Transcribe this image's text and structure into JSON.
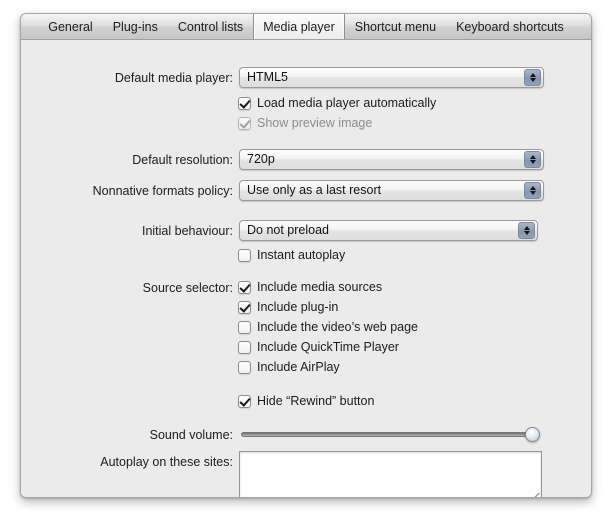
{
  "tabs": [
    {
      "label": "General",
      "active": false
    },
    {
      "label": "Plug-ins",
      "active": false
    },
    {
      "label": "Control lists",
      "active": false
    },
    {
      "label": "Media player",
      "active": true
    },
    {
      "label": "Shortcut menu",
      "active": false
    },
    {
      "label": "Keyboard shortcuts",
      "active": false
    }
  ],
  "fields": {
    "default_media_player_label": "Default media player:",
    "default_media_player_value": "HTML5",
    "default_resolution_label": "Default resolution:",
    "default_resolution_value": "720p",
    "nonnative_label": "Nonnative formats policy:",
    "nonnative_value": "Use only as a last resort",
    "initial_behaviour_label": "Initial behaviour:",
    "initial_behaviour_value": "Do not preload",
    "source_selector_label": "Source selector:",
    "sound_volume_label": "Sound volume:",
    "autoplay_label": "Autoplay on these sites:",
    "autoplay_value": ""
  },
  "checkboxes": {
    "load_media_player": {
      "label": "Load media player automatically",
      "checked": true,
      "disabled": false
    },
    "show_preview": {
      "label": "Show preview image",
      "checked": true,
      "disabled": true
    },
    "instant_autoplay": {
      "label": "Instant autoplay",
      "checked": false,
      "disabled": false
    },
    "include_media_sources": {
      "label": "Include media sources",
      "checked": true,
      "disabled": false
    },
    "include_plugin": {
      "label": "Include plug-in",
      "checked": true,
      "disabled": false
    },
    "include_web_page": {
      "label": "Include the video’s web page",
      "checked": false,
      "disabled": false
    },
    "include_quicktime": {
      "label": "Include QuickTime Player",
      "checked": false,
      "disabled": false
    },
    "include_airplay": {
      "label": "Include AirPlay",
      "checked": false,
      "disabled": false
    },
    "hide_rewind": {
      "label": "Hide “Rewind” button",
      "checked": true,
      "disabled": false
    }
  },
  "slider": {
    "value": 100,
    "min": 0,
    "max": 100
  },
  "colors": {
    "panel_background": "#ebebeb",
    "stepper_blue": "#8e9db5",
    "text": "#1c1c1c",
    "disabled_text": "#8c8c8c"
  }
}
